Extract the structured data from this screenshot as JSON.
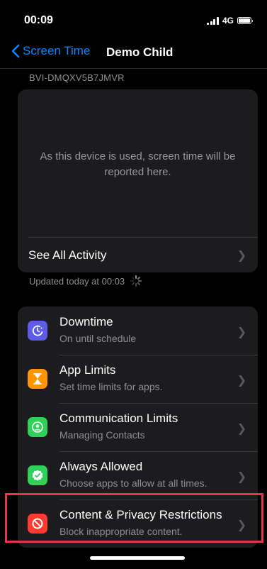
{
  "status_bar": {
    "time": "00:09",
    "network": "4G"
  },
  "nav": {
    "back_label": "Screen Time",
    "title": "Demo Child"
  },
  "device_id": "BVI-DMQXV5B7JMVR",
  "activity": {
    "empty_message": "As this device is used, screen time will be reported here.",
    "see_all_label": "See All Activity"
  },
  "updated_text": "Updated today at 00:03",
  "settings": [
    {
      "title": "Downtime",
      "subtitle": "On until schedule",
      "icon": "downtime-icon",
      "color": "#5e5ce6"
    },
    {
      "title": "App Limits",
      "subtitle": "Set time limits for apps.",
      "icon": "hourglass-icon",
      "color": "#ff9500"
    },
    {
      "title": "Communication Limits",
      "subtitle": "Managing Contacts",
      "icon": "person-circle-icon",
      "color": "#30d158"
    },
    {
      "title": "Always Allowed",
      "subtitle": "Choose apps to allow at all times.",
      "icon": "checkmark-seal-icon",
      "color": "#30d158"
    },
    {
      "title": "Content & Privacy Restrictions",
      "subtitle": "Block inappropriate content.",
      "icon": "no-entry-icon",
      "color": "#ff3b30"
    }
  ],
  "highlight_color": "#e8334b",
  "accent_color": "#0a84ff"
}
